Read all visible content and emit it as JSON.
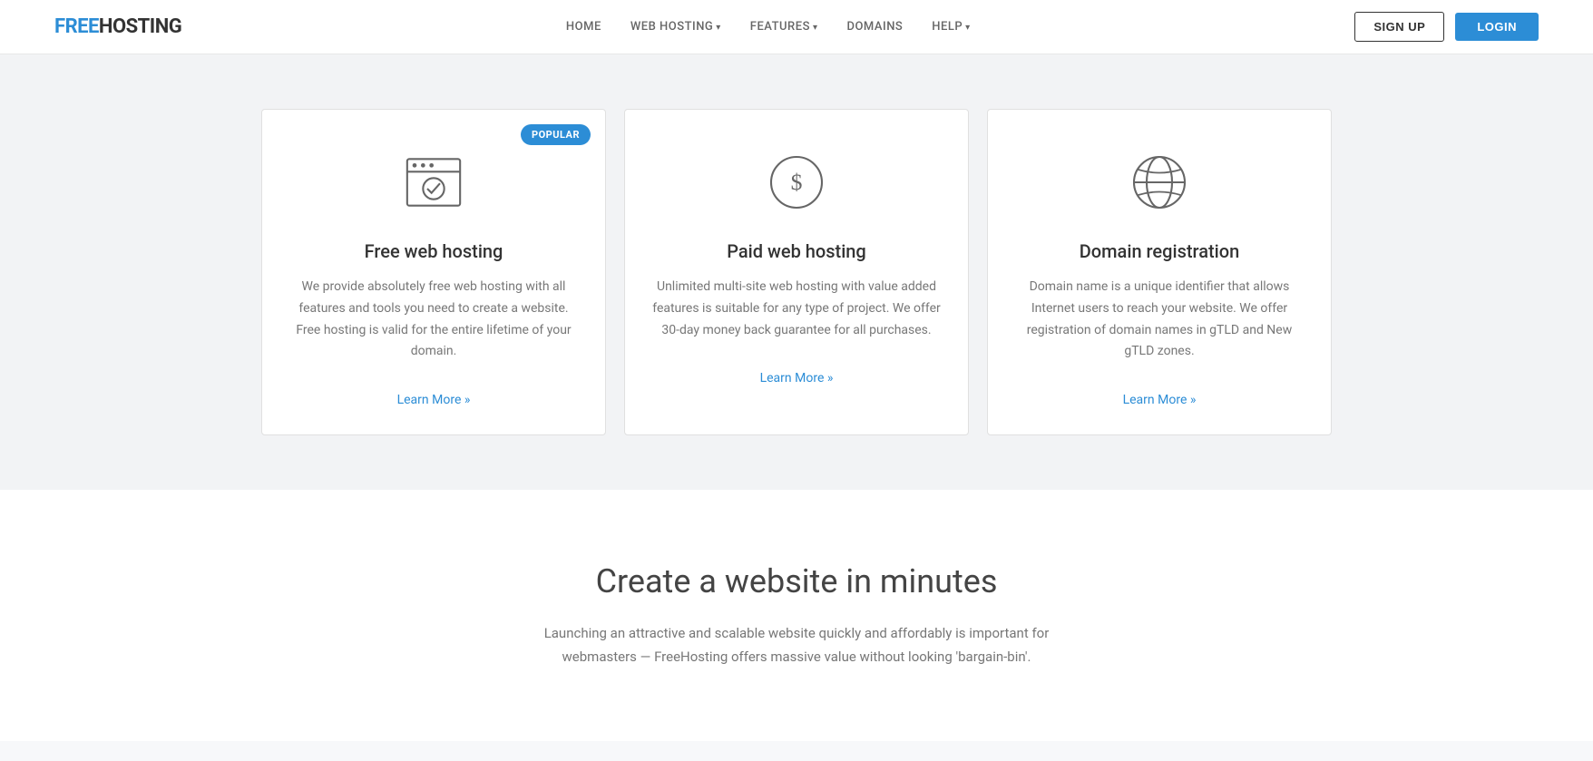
{
  "logo": {
    "free": "FREE",
    "hosting": "HOSTING"
  },
  "nav": {
    "items": [
      {
        "label": "HOME",
        "dropdown": false
      },
      {
        "label": "WEB HOSTING",
        "dropdown": true
      },
      {
        "label": "FEATURES",
        "dropdown": true
      },
      {
        "label": "DOMAINS",
        "dropdown": false
      },
      {
        "label": "HELP",
        "dropdown": true
      }
    ]
  },
  "header_buttons": {
    "signup": "SIGN UP",
    "login": "LOGIN"
  },
  "cards": [
    {
      "id": "free-hosting",
      "badge": "POPULAR",
      "title": "Free web hosting",
      "description": "We provide absolutely free web hosting with all features and tools you need to create a website. Free hosting is valid for the entire lifetime of your domain.",
      "link": "Learn More »",
      "icon": "browser-check"
    },
    {
      "id": "paid-hosting",
      "badge": null,
      "title": "Paid web hosting",
      "description": "Unlimited multi-site web hosting with value added features is suitable for any type of project. We offer 30-day money back guarantee for all purchases.",
      "link": "Learn More »",
      "icon": "dollar-circle"
    },
    {
      "id": "domain-registration",
      "badge": null,
      "title": "Domain registration",
      "description": "Domain name is a unique identifier that allows Internet users to reach your website. We offer registration of domain names in gTLD and New gTLD zones.",
      "link": "Learn More »",
      "icon": "globe"
    }
  ],
  "cta": {
    "title": "Create a website in minutes",
    "description": "Launching an attractive and scalable website quickly and affordably is important for webmasters — FreeHosting offers massive value without looking 'bargain-bin'."
  }
}
